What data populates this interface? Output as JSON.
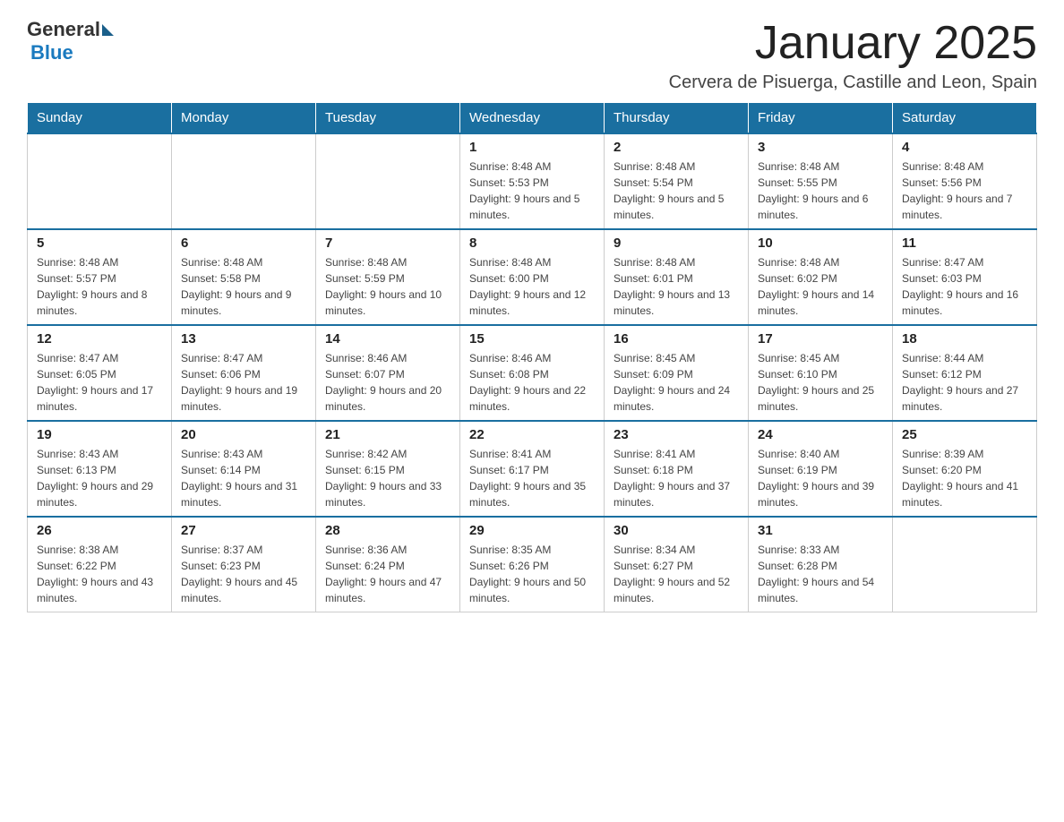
{
  "header": {
    "logo_general": "General",
    "logo_blue": "Blue",
    "month_title": "January 2025",
    "location": "Cervera de Pisuerga, Castille and Leon, Spain"
  },
  "days_of_week": [
    "Sunday",
    "Monday",
    "Tuesday",
    "Wednesday",
    "Thursday",
    "Friday",
    "Saturday"
  ],
  "weeks": [
    {
      "days": [
        {
          "number": "",
          "info": ""
        },
        {
          "number": "",
          "info": ""
        },
        {
          "number": "",
          "info": ""
        },
        {
          "number": "1",
          "info": "Sunrise: 8:48 AM\nSunset: 5:53 PM\nDaylight: 9 hours and 5 minutes."
        },
        {
          "number": "2",
          "info": "Sunrise: 8:48 AM\nSunset: 5:54 PM\nDaylight: 9 hours and 5 minutes."
        },
        {
          "number": "3",
          "info": "Sunrise: 8:48 AM\nSunset: 5:55 PM\nDaylight: 9 hours and 6 minutes."
        },
        {
          "number": "4",
          "info": "Sunrise: 8:48 AM\nSunset: 5:56 PM\nDaylight: 9 hours and 7 minutes."
        }
      ]
    },
    {
      "days": [
        {
          "number": "5",
          "info": "Sunrise: 8:48 AM\nSunset: 5:57 PM\nDaylight: 9 hours and 8 minutes."
        },
        {
          "number": "6",
          "info": "Sunrise: 8:48 AM\nSunset: 5:58 PM\nDaylight: 9 hours and 9 minutes."
        },
        {
          "number": "7",
          "info": "Sunrise: 8:48 AM\nSunset: 5:59 PM\nDaylight: 9 hours and 10 minutes."
        },
        {
          "number": "8",
          "info": "Sunrise: 8:48 AM\nSunset: 6:00 PM\nDaylight: 9 hours and 12 minutes."
        },
        {
          "number": "9",
          "info": "Sunrise: 8:48 AM\nSunset: 6:01 PM\nDaylight: 9 hours and 13 minutes."
        },
        {
          "number": "10",
          "info": "Sunrise: 8:48 AM\nSunset: 6:02 PM\nDaylight: 9 hours and 14 minutes."
        },
        {
          "number": "11",
          "info": "Sunrise: 8:47 AM\nSunset: 6:03 PM\nDaylight: 9 hours and 16 minutes."
        }
      ]
    },
    {
      "days": [
        {
          "number": "12",
          "info": "Sunrise: 8:47 AM\nSunset: 6:05 PM\nDaylight: 9 hours and 17 minutes."
        },
        {
          "number": "13",
          "info": "Sunrise: 8:47 AM\nSunset: 6:06 PM\nDaylight: 9 hours and 19 minutes."
        },
        {
          "number": "14",
          "info": "Sunrise: 8:46 AM\nSunset: 6:07 PM\nDaylight: 9 hours and 20 minutes."
        },
        {
          "number": "15",
          "info": "Sunrise: 8:46 AM\nSunset: 6:08 PM\nDaylight: 9 hours and 22 minutes."
        },
        {
          "number": "16",
          "info": "Sunrise: 8:45 AM\nSunset: 6:09 PM\nDaylight: 9 hours and 24 minutes."
        },
        {
          "number": "17",
          "info": "Sunrise: 8:45 AM\nSunset: 6:10 PM\nDaylight: 9 hours and 25 minutes."
        },
        {
          "number": "18",
          "info": "Sunrise: 8:44 AM\nSunset: 6:12 PM\nDaylight: 9 hours and 27 minutes."
        }
      ]
    },
    {
      "days": [
        {
          "number": "19",
          "info": "Sunrise: 8:43 AM\nSunset: 6:13 PM\nDaylight: 9 hours and 29 minutes."
        },
        {
          "number": "20",
          "info": "Sunrise: 8:43 AM\nSunset: 6:14 PM\nDaylight: 9 hours and 31 minutes."
        },
        {
          "number": "21",
          "info": "Sunrise: 8:42 AM\nSunset: 6:15 PM\nDaylight: 9 hours and 33 minutes."
        },
        {
          "number": "22",
          "info": "Sunrise: 8:41 AM\nSunset: 6:17 PM\nDaylight: 9 hours and 35 minutes."
        },
        {
          "number": "23",
          "info": "Sunrise: 8:41 AM\nSunset: 6:18 PM\nDaylight: 9 hours and 37 minutes."
        },
        {
          "number": "24",
          "info": "Sunrise: 8:40 AM\nSunset: 6:19 PM\nDaylight: 9 hours and 39 minutes."
        },
        {
          "number": "25",
          "info": "Sunrise: 8:39 AM\nSunset: 6:20 PM\nDaylight: 9 hours and 41 minutes."
        }
      ]
    },
    {
      "days": [
        {
          "number": "26",
          "info": "Sunrise: 8:38 AM\nSunset: 6:22 PM\nDaylight: 9 hours and 43 minutes."
        },
        {
          "number": "27",
          "info": "Sunrise: 8:37 AM\nSunset: 6:23 PM\nDaylight: 9 hours and 45 minutes."
        },
        {
          "number": "28",
          "info": "Sunrise: 8:36 AM\nSunset: 6:24 PM\nDaylight: 9 hours and 47 minutes."
        },
        {
          "number": "29",
          "info": "Sunrise: 8:35 AM\nSunset: 6:26 PM\nDaylight: 9 hours and 50 minutes."
        },
        {
          "number": "30",
          "info": "Sunrise: 8:34 AM\nSunset: 6:27 PM\nDaylight: 9 hours and 52 minutes."
        },
        {
          "number": "31",
          "info": "Sunrise: 8:33 AM\nSunset: 6:28 PM\nDaylight: 9 hours and 54 minutes."
        },
        {
          "number": "",
          "info": ""
        }
      ]
    }
  ]
}
